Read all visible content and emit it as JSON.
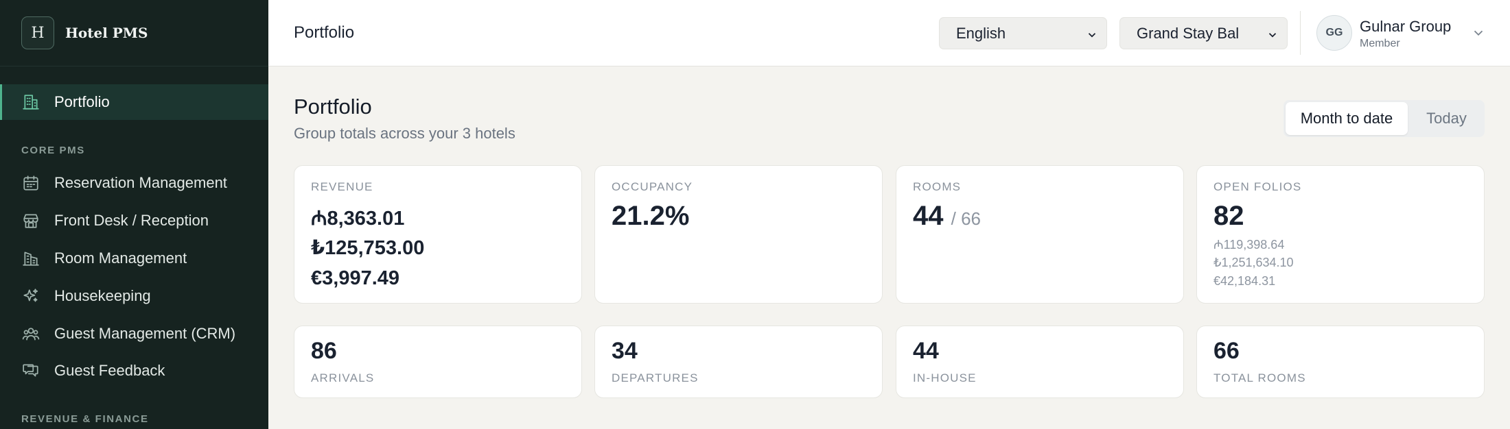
{
  "brand": {
    "logo_letter": "H",
    "name": "Hotel PMS"
  },
  "sidebar": {
    "active": {
      "label": "Portfolio",
      "icon": "building-icon"
    },
    "sections": [
      {
        "title": "CORE PMS",
        "items": [
          {
            "label": "Reservation Management",
            "icon": "calendar-icon"
          },
          {
            "label": "Front Desk / Reception",
            "icon": "storefront-icon"
          },
          {
            "label": "Room Management",
            "icon": "buildings-icon"
          },
          {
            "label": "Housekeeping",
            "icon": "sparkles-icon"
          },
          {
            "label": "Guest Management (CRM)",
            "icon": "users-icon"
          },
          {
            "label": "Guest Feedback",
            "icon": "chat-icon"
          }
        ]
      },
      {
        "title": "REVENUE & FINANCE",
        "items": []
      }
    ]
  },
  "topbar": {
    "title": "Portfolio",
    "language_select": {
      "value": "English"
    },
    "hotel_select": {
      "value": "Grand Stay Bal"
    },
    "user": {
      "initials": "GG",
      "name": "Gulnar Group",
      "role": "Member"
    }
  },
  "main": {
    "title": "Portfolio",
    "subtitle": "Group totals across your 3 hotels",
    "period_toggle": {
      "options": [
        "Month to date",
        "Today"
      ],
      "active": "Month to date"
    },
    "kpis": {
      "revenue": {
        "label": "REVENUE",
        "values": [
          "₼8,363.01",
          "₺125,753.00",
          "€3,997.49"
        ]
      },
      "occupancy": {
        "label": "OCCUPANCY",
        "value": "21.2%"
      },
      "rooms": {
        "label": "ROOMS",
        "value": "44",
        "total": "/ 66"
      },
      "open_folios": {
        "label": "OPEN FOLIOS",
        "value": "82",
        "amounts": [
          "₼119,398.64",
          "₺1,251,634.10",
          "€42,184.31"
        ]
      }
    },
    "stats": [
      {
        "value": "86",
        "label": "ARRIVALS"
      },
      {
        "value": "34",
        "label": "DEPARTURES"
      },
      {
        "value": "44",
        "label": "IN-HOUSE"
      },
      {
        "value": "66",
        "label": "TOTAL ROOMS"
      }
    ]
  },
  "colors": {
    "sidebar_bg": "#162320",
    "accent": "#4fb38d",
    "page_bg": "#f4f3ef"
  }
}
